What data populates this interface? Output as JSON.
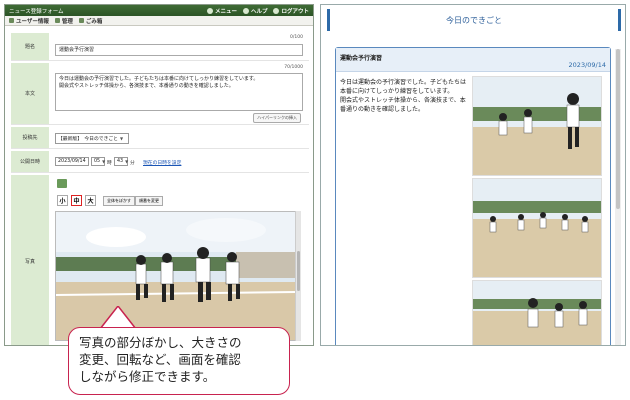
{
  "left_window": {
    "title": "ニュース登録フォーム",
    "title_links": [
      "メニュー",
      "ヘルプ",
      "ログアウト"
    ],
    "menu_items": [
      "ユーザー情報",
      "管理",
      "ごみ箱"
    ],
    "form": {
      "title_label": "題名",
      "title_counter": "0/100",
      "title_value": "運動会予行演習",
      "body_label": "本文",
      "body_counter": "70/1000",
      "body_value": "今日は運動会の予行演習でした。子どもたちは本番に向けてしっかり練習をしています。\n開会式やストレッチ体操から、各演技まで、本番通りの動きを確認しました。",
      "hyperlink_button": "ハイパーリンクの挿入",
      "category_label": "投稿先",
      "category_value": "【最新版】　今日のできごと",
      "date_label": "公開日時",
      "date_value": "2023/09/14",
      "hour_value": "05",
      "hour_unit": "時",
      "minute_value": "43",
      "minute_unit": "分",
      "now_link": "現在の日時を設定",
      "photo_label": "写真",
      "size_small": "小",
      "size_medium": "中",
      "size_large": "大",
      "blur_button": "全体をぼかす",
      "rotate_button": "順番を変更"
    }
  },
  "right_window": {
    "header": "今日のできごと",
    "card_title": "運動会予行演習",
    "card_date": "2023/09/14",
    "card_text": "今日は運動会の予行演習でした。子どもたちは本番に向けてしっかり練習をしています。\n開会式やストレッチ体操から、各演技まで、本番通りの動きを確認しました。"
  },
  "callout": {
    "text": "写真の部分ぼかし、大きさの\n変更、回転など、画面を確認\nしながら修正できます。"
  },
  "colors": {
    "title_bar": "#2c5426",
    "label_bg": "#dcebd2",
    "accent_blue": "#2d6aa8",
    "callout_border": "#c8234f"
  }
}
